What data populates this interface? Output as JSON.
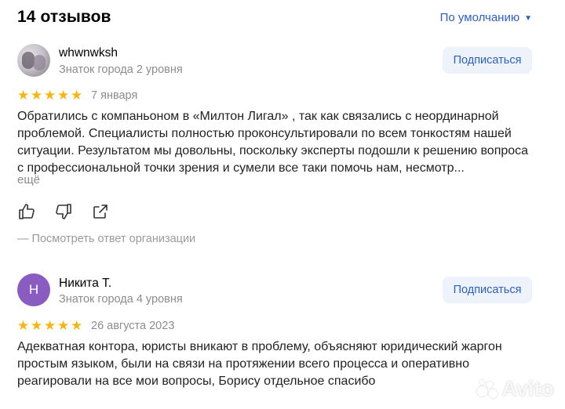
{
  "header": {
    "reviews_count_title": "14 отзывов",
    "sort_label": "По умолчанию"
  },
  "reviews": [
    {
      "author": "whwnwksh",
      "level": "Знаток города 2 уровня",
      "subscribe_label": "Подписаться",
      "rating": 5,
      "stars": "★★★★★",
      "date": "7 января",
      "text": "Обратились с компаньоном в «Милтон Лигал» , так как связались с неординарной проблемой. Специалисты полностью проконсультировали по всем тонкостям нашей ситуации. Результатом мы довольны, поскольку эксперты подошли к решению вопроса с профессиональной точки зрения и сумели все таки помочь нам, несмотр...",
      "more_label": "ещё",
      "org_answer_label": "— Посмотреть ответ организации"
    },
    {
      "author": "Никита Т.",
      "avatar_letter": "Н",
      "level": "Знаток города 4 уровня",
      "subscribe_label": "Подписаться",
      "rating": 5,
      "stars": "★★★★★",
      "date": "26 августа 2023",
      "text": "Адекватная контора, юристы вникают в проблему, объясняют юридический жаргон простым языком, были на связи на протяжении всего процесса и оперативно реагировали на все мои вопросы, Борису отдельное спасибо"
    }
  ],
  "colors": {
    "accent": "#2b5fc7",
    "star": "#f8b50e",
    "muted": "#8c8c8c",
    "button_bg": "#eef3fb",
    "avatar_letter_bg": "#8a5cc2"
  },
  "icons": [
    "like-icon",
    "dislike-icon",
    "share-icon",
    "avito-logo-icon"
  ],
  "watermark": {
    "text": "Avito"
  }
}
